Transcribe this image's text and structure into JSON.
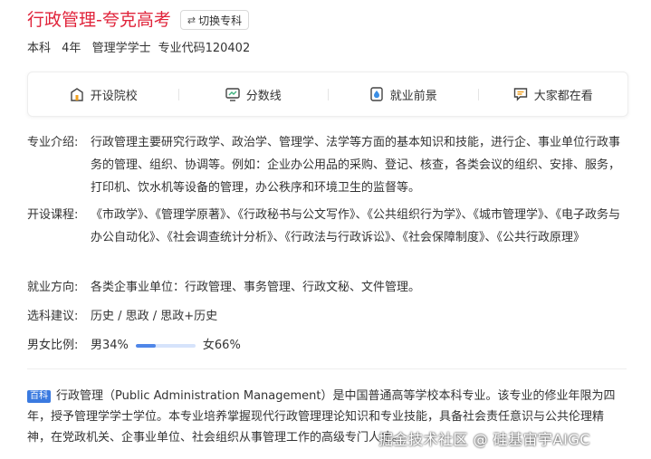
{
  "header": {
    "title_main": "行政管理",
    "title_sep": "-",
    "title_suffix": "夸克高考",
    "switch_label": "切换专科"
  },
  "meta": {
    "level": "本科",
    "duration": "4年",
    "degree": "管理学学士",
    "code": "专业代码120402"
  },
  "tabs": [
    {
      "label": "开设院校",
      "icon": "school-icon"
    },
    {
      "label": "分数线",
      "icon": "monitor-icon"
    },
    {
      "label": "就业前景",
      "icon": "drop-icon"
    },
    {
      "label": "大家都在看",
      "icon": "chat-icon"
    }
  ],
  "intro": {
    "label": "专业介绍:",
    "text": "行政管理主要研究行政学、政治学、管理学、法学等方面的基本知识和技能，进行企、事业单位行政事务的管理、组织、协调等。例如：企业办公用品的采购、登记、核查，各类会议的组织、安排、服务，打印机、饮水机等设备的管理，办公秩序和环境卫生的监督等。"
  },
  "courses": {
    "label": "开设课程:",
    "text": "《市政学》、《管理学原著》、《行政秘书与公文写作》、《公共组织行为学》、《城市管理学》、《电子政务与办公自动化》、《社会调查统计分析》、《行政法与行政诉讼》、《社会保障制度》、《公共行政原理》"
  },
  "employment": {
    "label": "就业方向:",
    "text": "各类企事业单位：行政管理、事务管理、行政文秘、文件管理。"
  },
  "subjects": {
    "label": "选科建议:",
    "text": "历史 / 思政 / 思政+历史"
  },
  "ratio": {
    "label": "男女比例:",
    "male_label": "男34%",
    "female_label": "女66%",
    "male_fraction": 0.34
  },
  "baike": {
    "badge": "百科",
    "text": "行政管理（Public Administration Management）是中国普通高等学校本科专业。该专业的修业年限为四年，授予管理学学士学位。本专业培养掌握现代行政管理理论知识和专业技能，具备社会责任意识与公共伦理精神，在党政机关、企事业单位、社会组织从事管理工作的高级专门人才。"
  },
  "watermark": "掘金技术社区 @ 硅基宙宇AIGC",
  "colors": {
    "accent": "#e0233a",
    "bar_fill": "#4f86e8",
    "bar_track": "#d6e3fb",
    "badge": "#3a7ae0"
  }
}
